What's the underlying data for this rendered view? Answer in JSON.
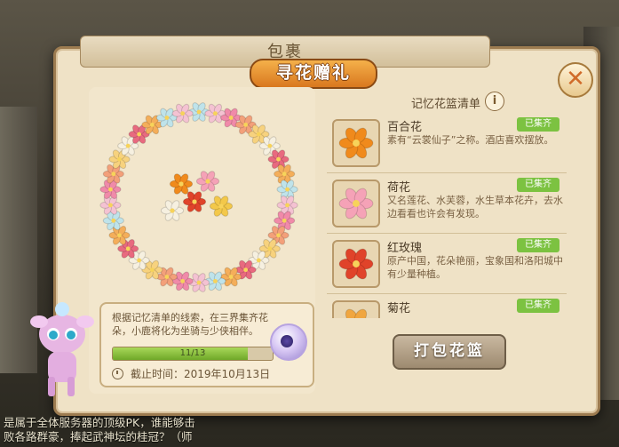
{
  "header": {
    "title": "包裹",
    "ribbon_title": "寻花赠礼",
    "close_label": "✕"
  },
  "info": {
    "description": "根据记忆清单的线索，在三界集齐花朵，小鹿将化为坐骑与少侠相伴。",
    "progress_text": "11/13",
    "progress_fraction": 0.846,
    "deadline": "截止时间：2019年10月13日"
  },
  "list": {
    "title": "记忆花篮清单",
    "info_icon": "i",
    "items": [
      {
        "name": "百合花",
        "desc": "素有“云裳仙子”之称。酒店喜欢摆放。",
        "status": "已集齐",
        "color": "#f08a1c"
      },
      {
        "name": "荷花",
        "desc": "又名莲花、水芙蓉，水生草本花卉，去水边看看也许会有发现。",
        "status": "已集齐",
        "color": "#f5a2b7"
      },
      {
        "name": "红玫瑰",
        "desc": "原产中国，花朵艳丽，宝象国和洛阳城中有少量种植。",
        "status": "已集齐",
        "color": "#e0432a"
      },
      {
        "name": "菊花",
        "desc": "",
        "status": "已集齐",
        "color": "#f0a640"
      }
    ]
  },
  "pack_button": "打包花篮",
  "chat": {
    "line1": "是属于全体服务器的顶级PK，谁能够击",
    "line2": "败各路群豪，捧起武神坛的桂冠？（师"
  },
  "colors": {
    "panel": "#efe2c6",
    "accent": "#d9781f",
    "collected": "#7cc241"
  }
}
